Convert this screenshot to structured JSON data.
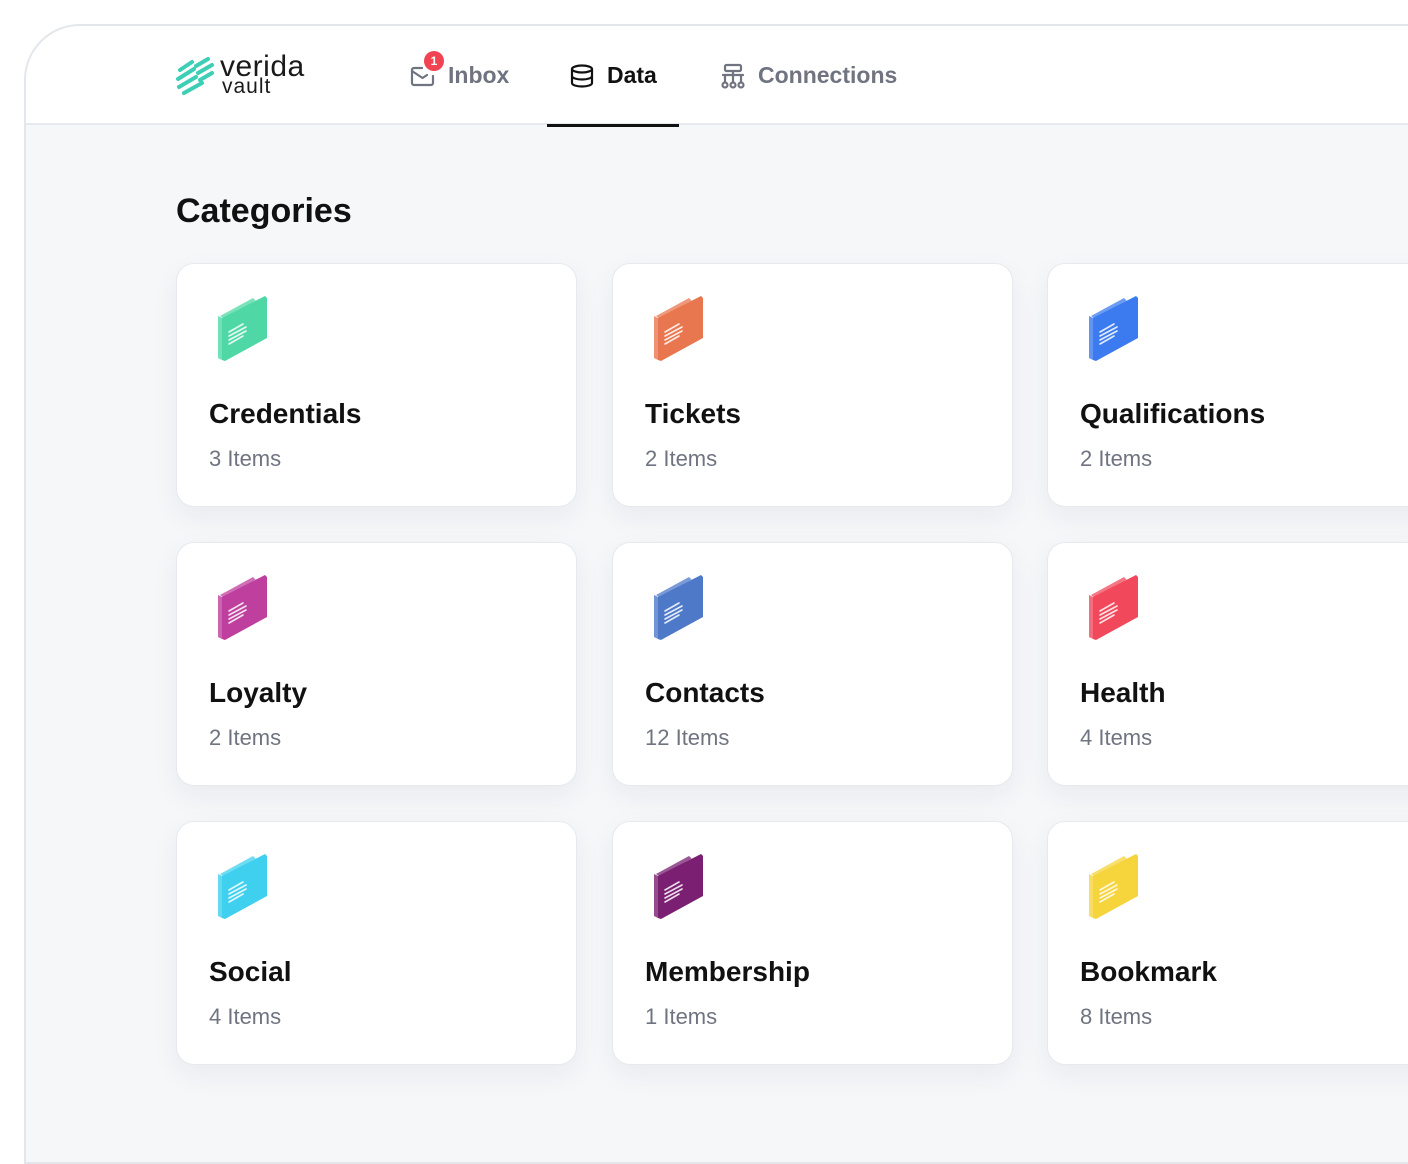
{
  "brand": {
    "name": "verida",
    "sub": "vault",
    "accent": "#3ccfb5"
  },
  "nav": [
    {
      "label": "Inbox",
      "icon": "inbox-icon",
      "badge": "1",
      "active": false
    },
    {
      "label": "Data",
      "icon": "database-icon",
      "active": true
    },
    {
      "label": "Connections",
      "icon": "connections-icon",
      "active": false
    }
  ],
  "page": {
    "title": "Categories"
  },
  "categories": [
    {
      "name": "Credentials",
      "count": "3 Items",
      "color": "#4fd8a6",
      "icon": "folder-icon"
    },
    {
      "name": "Tickets",
      "count": "2 Items",
      "color": "#e8774f",
      "icon": "folder-icon"
    },
    {
      "name": "Qualifications",
      "count": "2 Items",
      "color": "#3b7bef",
      "icon": "folder-icon"
    },
    {
      "name": "Loyalty",
      "count": "2 Items",
      "color": "#bf3f9e",
      "icon": "folder-icon"
    },
    {
      "name": "Contacts",
      "count": "12 Items",
      "color": "#4e79c9",
      "icon": "folder-icon"
    },
    {
      "name": "Health",
      "count": "4 Items",
      "color": "#f2485b",
      "icon": "folder-icon"
    },
    {
      "name": "Social",
      "count": "4 Items",
      "color": "#3fd0ef",
      "icon": "folder-icon"
    },
    {
      "name": "Membership",
      "count": "1 Items",
      "color": "#7a1f72",
      "icon": "folder-icon"
    },
    {
      "name": "Bookmark",
      "count": "8 Items",
      "color": "#f5d43c",
      "icon": "folder-icon"
    }
  ]
}
